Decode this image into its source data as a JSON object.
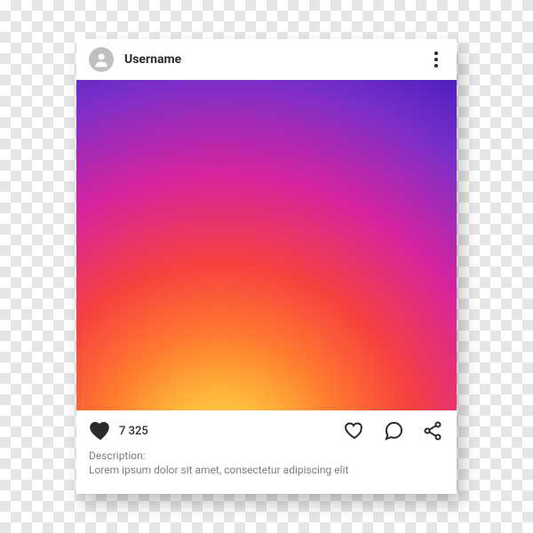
{
  "header": {
    "username": "Username"
  },
  "likes": {
    "count_text": "7 325"
  },
  "description": {
    "label": "Description:",
    "text": "Lorem ipsum dolor sit amet, consectetur adipiscing elit"
  }
}
